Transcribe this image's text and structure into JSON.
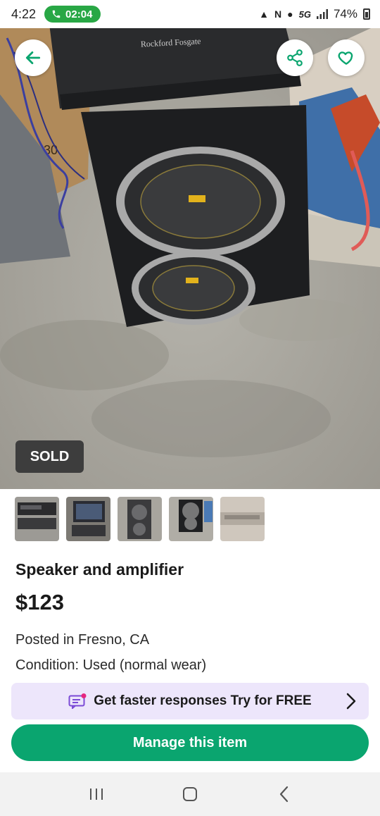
{
  "status_bar": {
    "time": "4:22",
    "call_timer": "02:04",
    "network": "5G",
    "battery": "74%"
  },
  "hero": {
    "badge": "SOLD",
    "amplifier_logo": "Rockford Fosgate"
  },
  "listing": {
    "title": "Speaker and amplifier",
    "price": "$123",
    "location": "Posted in Fresno, CA",
    "condition": "Condition: Used (normal wear)"
  },
  "promo": {
    "text": "Get faster responses Try for FREE"
  },
  "actions": {
    "manage_label": "Manage this item"
  },
  "colors": {
    "accent_green": "#0aa56f",
    "promo_bg": "#ede6fb",
    "badge_bg": "#3d3d3d",
    "promo_icon": "#7b4bd6",
    "promo_dot": "#e6267f"
  },
  "icons": {
    "back": "arrow-left-icon",
    "share": "share-icon",
    "favorite": "heart-icon",
    "promo": "chat-message-icon",
    "promo_chevron": "chevron-right-icon",
    "nav_recents": "recents-icon",
    "nav_home": "home-icon",
    "nav_back": "back-chevron-icon"
  }
}
